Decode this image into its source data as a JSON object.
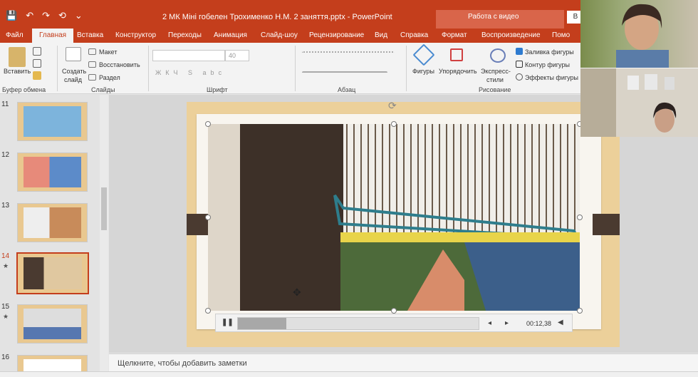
{
  "titlebar": {
    "quick_access": [
      "💾",
      "↶",
      "↷",
      "⟲",
      "⌄"
    ],
    "title": "2 МК Міні гобелен Трохименко Н.М. 2 заняття.pptx  -  PowerPoint",
    "context_group": "Работа с видео",
    "account_btn": "В"
  },
  "tabs": [
    {
      "label": "Файл"
    },
    {
      "label": "Главная",
      "active": true
    },
    {
      "label": "Вставка"
    },
    {
      "label": "Конструктор"
    },
    {
      "label": "Переходы"
    },
    {
      "label": "Анимация"
    },
    {
      "label": "Слайд-шоу"
    },
    {
      "label": "Рецензирование"
    },
    {
      "label": "Вид"
    },
    {
      "label": "Справка"
    },
    {
      "label": "Формат"
    },
    {
      "label": "Воспроизведение"
    },
    {
      "label": "Помо"
    }
  ],
  "ribbon": {
    "clipboard": {
      "paste": "Вставить",
      "group": "Буфер обмена"
    },
    "slides": {
      "new_slide": "Создать",
      "new_slide2": "слайд",
      "layout": "Макет",
      "reset": "Восстановить",
      "section": "Раздел",
      "group": "Слайды"
    },
    "font": {
      "font_size": "40",
      "group": "Шрифт"
    },
    "paragraph": {
      "group": "Абзац"
    },
    "drawing": {
      "shapes": "Фигуры",
      "arrange": "Упорядочить",
      "quick_styles": "Экспресс-",
      "quick_styles2": "стили",
      "fill": "Заливка фигуры",
      "outline": "Контур фигуры",
      "effects": "Эффекты фигуры",
      "group": "Рисование"
    }
  },
  "slides": [
    {
      "num": "11",
      "star": ""
    },
    {
      "num": "12",
      "star": ""
    },
    {
      "num": "13",
      "star": ""
    },
    {
      "num": "14",
      "star": "★",
      "selected": true
    },
    {
      "num": "15",
      "star": "★"
    },
    {
      "num": "16",
      "star": ""
    }
  ],
  "video": {
    "time": "00:12,38",
    "progress": 0.2
  },
  "notes_placeholder": "Щелкните, чтобы добавить заметки",
  "colors": {
    "accent": "#c43e1c"
  }
}
